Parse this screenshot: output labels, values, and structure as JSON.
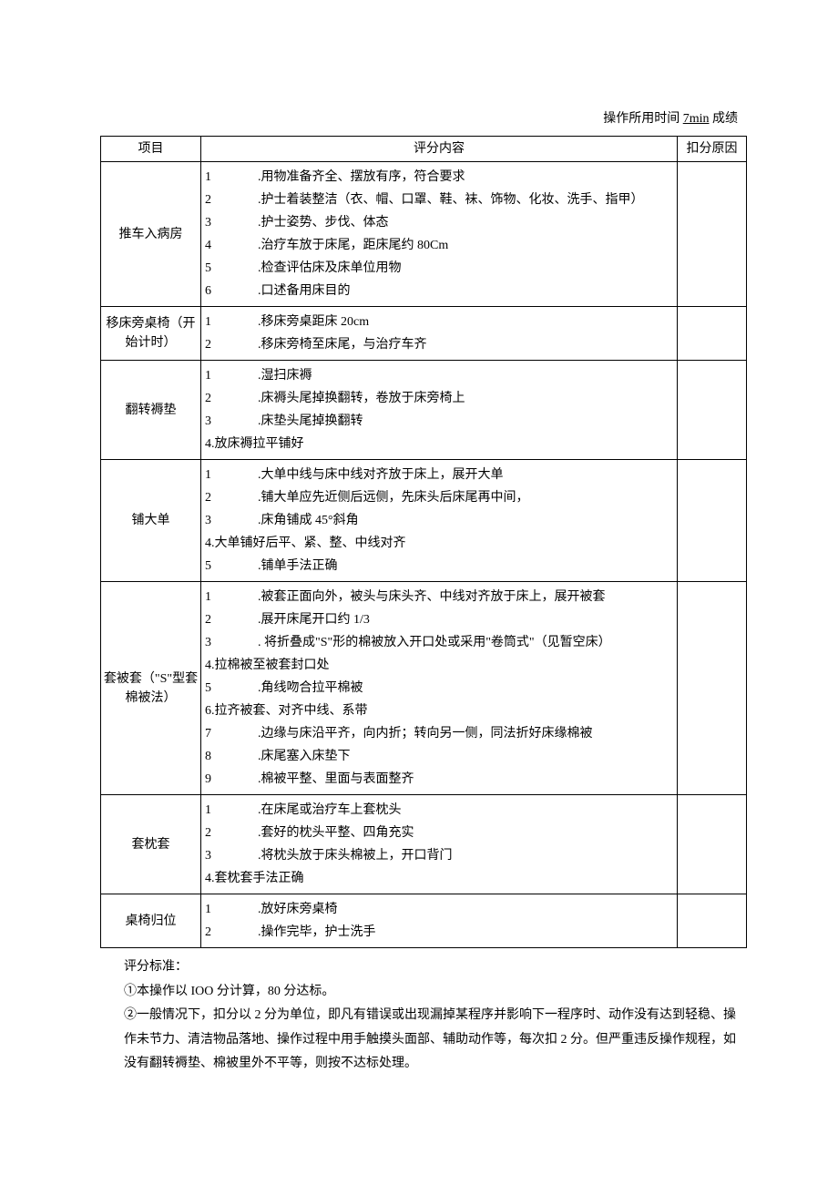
{
  "header": {
    "prefix": "操作所用时间",
    "time": "7min",
    "suffix": "成绩"
  },
  "columns": {
    "project": "项目",
    "content": "评分内容",
    "reason": "扣分原因"
  },
  "rows": [
    {
      "project": "推车入病房",
      "items": [
        {
          "n": "1",
          "t": ".用物准备齐全、摆放有序，符合要求"
        },
        {
          "n": "2",
          "t": ".护士着装整洁（衣、帽、口罩、鞋、袜、饰物、化妆、洗手、指甲）",
          "wrap": true
        },
        {
          "n": "3",
          "t": ".护士姿势、步伐、体态"
        },
        {
          "n": "4",
          "t": ".治疗车放于床尾，距床尾约 80Cm"
        },
        {
          "n": "5",
          "t": ".检查评估床及床单位用物"
        },
        {
          "n": "6",
          "t": ".口述备用床目的"
        }
      ]
    },
    {
      "project": "移床旁桌椅（开始计时）",
      "items": [
        {
          "n": "1",
          "t": ".移床旁桌距床 20cm"
        },
        {
          "n": "2",
          "t": ".移床旁椅至床尾，与治疗车齐"
        }
      ]
    },
    {
      "project": "翻转褥垫",
      "items": [
        {
          "n": "1",
          "t": ".湿扫床褥"
        },
        {
          "n": "2",
          "t": ".床褥头尾掉换翻转，卷放于床旁椅上"
        },
        {
          "n": "3",
          "t": ".床垫头尾掉换翻转"
        },
        {
          "plain": "4.放床褥拉平铺好"
        }
      ]
    },
    {
      "project": "铺大单",
      "items": [
        {
          "n": "1",
          "t": ".大单中线与床中线对齐放于床上，展开大单"
        },
        {
          "n": "2",
          "t": ".铺大单应先近侧后远侧，先床头后床尾再中间，"
        },
        {
          "n": "3",
          "t": ".床角铺成 45°斜角"
        },
        {
          "plain": "4.大单铺好后平、紧、整、中线对齐"
        },
        {
          "n": "5",
          "t": ".铺单手法正确"
        }
      ]
    },
    {
      "project": "套被套（\"S\"型套棉被法）",
      "items": [
        {
          "n": "1",
          "t": ".被套正面向外，被头与床头齐、中线对齐放于床上，展开被套",
          "wrap": true
        },
        {
          "n": "2",
          "t": ".展开床尾开口约 1/3"
        },
        {
          "n": "3",
          "t": ". 将折叠成\"S\"形的棉被放入开口处或采用\"卷筒式\"（见暂空床）",
          "wrap": true
        },
        {
          "plain": "4.拉棉被至被套封口处"
        },
        {
          "n": "5",
          "t": ".角线吻合拉平棉被"
        },
        {
          "plain": "6.拉齐被套、对齐中线、系带"
        },
        {
          "n": "7",
          "t": ".边缘与床沿平齐，向内折；转向另一侧，同法折好床缘棉被"
        },
        {
          "n": "8",
          "t": ".床尾塞入床垫下"
        },
        {
          "n": "9",
          "t": ".棉被平整、里面与表面整齐"
        }
      ]
    },
    {
      "project": "套枕套",
      "items": [
        {
          "n": "1",
          "t": ".在床尾或治疗车上套枕头"
        },
        {
          "n": "2",
          "t": ".套好的枕头平整、四角充实"
        },
        {
          "n": "3",
          "t": ".将枕头放于床头棉被上，开口背门"
        },
        {
          "plain": "4.套枕套手法正确"
        }
      ]
    },
    {
      "project": "桌椅归位",
      "items": [
        {
          "n": "1",
          "t": ".放好床旁桌椅"
        },
        {
          "n": "2",
          "t": ".操作完毕，护士洗手"
        }
      ]
    }
  ],
  "footer": {
    "title": "评分标准：",
    "line1": "①本操作以 IOO 分计算，80 分达标。",
    "line2": "②一般情况下，扣分以 2 分为单位，即凡有错误或出现漏掉某程序并影响下一程序时、动作没有达到轻稳、操作未节力、清洁物品落地、操作过程中用手触摸头面部、辅助动作等，每次扣 2 分。但严重违反操作规程，如没有翻转褥垫、棉被里外不平等，则按不达标处理。"
  }
}
